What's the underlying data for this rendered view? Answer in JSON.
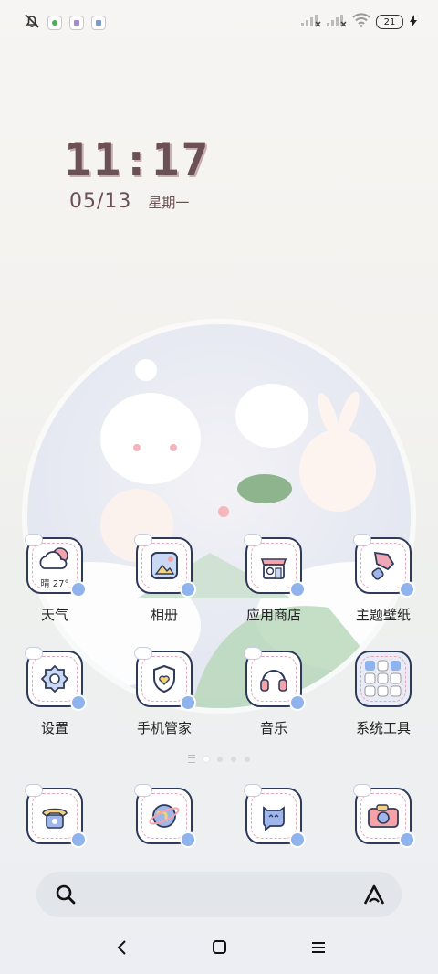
{
  "status": {
    "battery": "21",
    "icons": [
      "bell-off-icon",
      "green-app-icon",
      "purple-app-icon",
      "blue-app-icon",
      "signal-x-icon",
      "signal-x-icon",
      "wifi-icon",
      "battery-icon",
      "charging-icon"
    ]
  },
  "clock": {
    "time": "11:17",
    "date": "05/13",
    "weekday": "星期一"
  },
  "apps": [
    {
      "label": "天气",
      "icon": "weather-icon",
      "temp": "晴 27°"
    },
    {
      "label": "相册",
      "icon": "gallery-icon"
    },
    {
      "label": "应用商店",
      "icon": "app-store-icon"
    },
    {
      "label": "主题壁纸",
      "icon": "themes-icon"
    },
    {
      "label": "设置",
      "icon": "settings-icon"
    },
    {
      "label": "手机管家",
      "icon": "security-icon"
    },
    {
      "label": "音乐",
      "icon": "music-icon"
    },
    {
      "label": "系统工具",
      "icon": "system-tools-folder"
    }
  ],
  "dock": [
    {
      "icon": "phone-icon"
    },
    {
      "icon": "browser-icon"
    },
    {
      "icon": "messages-icon"
    },
    {
      "icon": "camera-icon"
    }
  ],
  "colors": {
    "accent": "#6b5055",
    "icon_border": "#2f3a5a",
    "dash": "#e4a8ba"
  }
}
